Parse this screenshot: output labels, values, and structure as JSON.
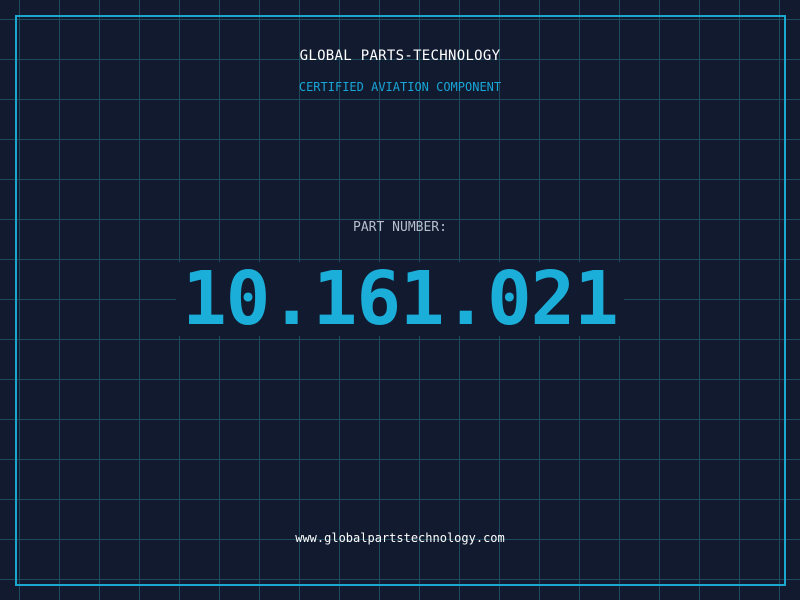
{
  "header": {
    "company": "GLOBAL PARTS-TECHNOLOGY",
    "tagline": "CERTIFIED AVIATION COMPONENT"
  },
  "part": {
    "label": "PART NUMBER:",
    "number": "10.161.021"
  },
  "footer": {
    "website": "www.globalpartstechnology.com"
  },
  "colors": {
    "background": "#121a30",
    "grid": "#1f4a5e",
    "accent": "#1aaed8",
    "text": "#ffffff"
  }
}
